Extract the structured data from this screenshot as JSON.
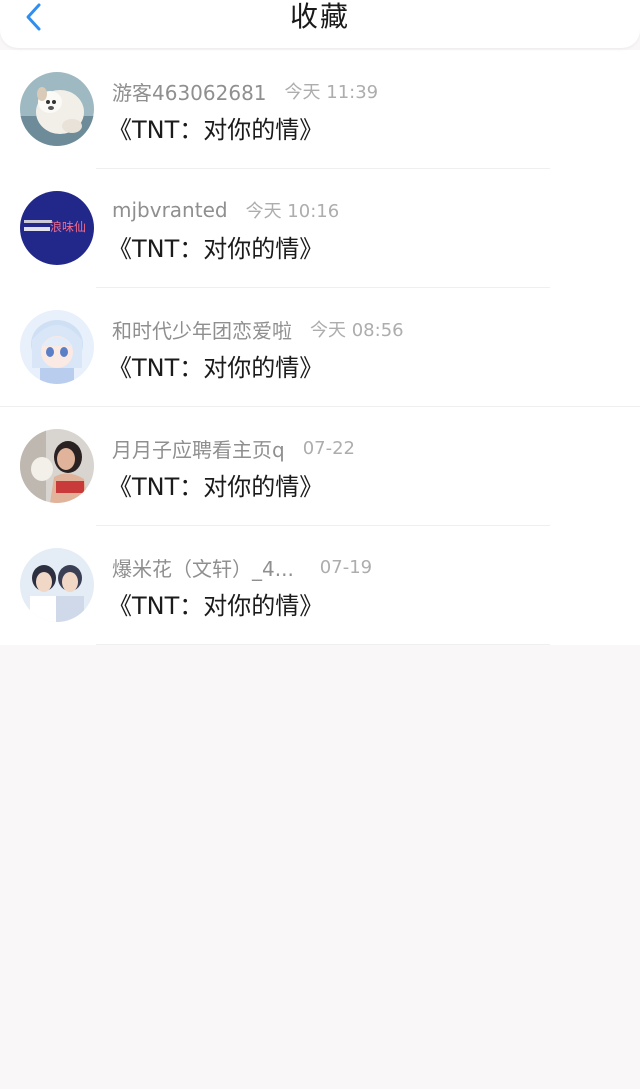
{
  "header": {
    "back_icon": "chevron-left-icon",
    "title": "收藏",
    "accent_color": "#2f8ff0"
  },
  "items": [
    {
      "username": "游客463062681",
      "time": "今天 11:39",
      "content": "《TNT：对你的情》",
      "avatar": "dog-photo"
    },
    {
      "username": "mjbvranted",
      "time": "今天 10:16",
      "content": "《TNT：对你的情》",
      "avatar": "text-logo",
      "avatar_text": "浪味仙"
    },
    {
      "username": "和时代少年团恋爱啦",
      "time": "今天 08:56",
      "content": "《TNT：对你的情》",
      "avatar": "anime-girl"
    },
    {
      "username": "月月子应聘看主页q",
      "time": "07-22",
      "content": "《TNT：对你的情》",
      "avatar": "photo-woman"
    },
    {
      "username": "爆米花（文轩）_4...",
      "time": "07-19",
      "content": "《TNT：对你的情》",
      "avatar": "photo-two-boys"
    }
  ]
}
